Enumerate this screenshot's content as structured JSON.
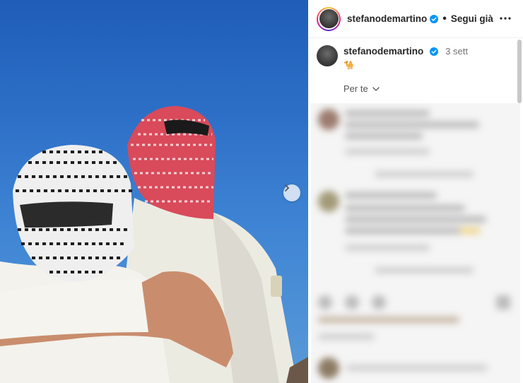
{
  "post": {
    "photo_alt": "",
    "next_icon": "chevron-right-icon"
  },
  "header": {
    "username": "stefanodemartino",
    "separator": "•",
    "follow_label": "Segui già",
    "more_icon": "more-horizontal-icon"
  },
  "caption": {
    "username": "stefanodemartino",
    "time": "3 sett",
    "emoji": "🐪"
  },
  "filter": {
    "label": "Per te"
  },
  "colors": {
    "verified": "#0095f6",
    "text": "#262626",
    "muted": "#737373",
    "sky": "#2d6fc7"
  }
}
